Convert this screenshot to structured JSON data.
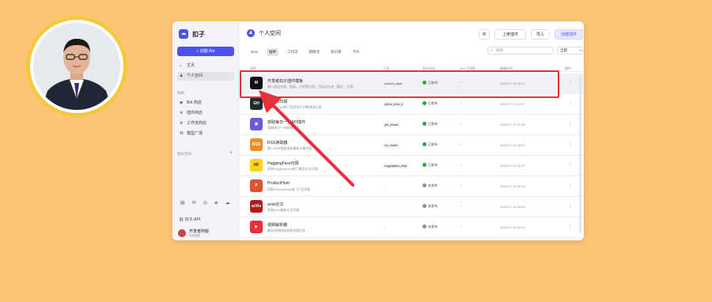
{
  "app": {
    "brand": "扣子",
    "create_bot": "+ 创建 Bot",
    "nav": [
      {
        "icon": "home-icon",
        "label": "主页",
        "glyph": "⌂"
      },
      {
        "icon": "person-icon",
        "label": "个人空间",
        "glyph": "♟"
      }
    ],
    "section_label": "探索",
    "explore": [
      {
        "icon": "bot-store-icon",
        "label": "Bot 商店",
        "glyph": "◉"
      },
      {
        "icon": "plugin-store-icon",
        "label": "插件商店",
        "glyph": "⊕"
      },
      {
        "icon": "workflow-store-icon",
        "label": "工作流商店",
        "glyph": "⚙"
      },
      {
        "icon": "model-plaza-icon",
        "label": "模型广场",
        "glyph": "⌘"
      }
    ],
    "team_label": "团队空间",
    "footer_brand": "扣子 API",
    "user_name": "开发者阿锐",
    "user_sub": "免费额度"
  },
  "workspace": {
    "title": "个人空间",
    "buttons": {
      "lang": "中",
      "publish": "上架插件",
      "import": "导入",
      "create": "创建插件"
    },
    "tabs": [
      "Bots",
      "插件",
      "工作流",
      "图像流",
      "知识库",
      "卡片"
    ],
    "search_placeholder": "搜索",
    "filter": "全部"
  },
  "table": {
    "headers": [
      "插件",
      "工具",
      "发布状态",
      "Bot 引用数",
      "编辑时间",
      "操作"
    ],
    "rows": [
      {
        "name": "开发者扣子插件模板",
        "desc": "输入商品名称、链接、介绍等内容，可自动生成（图片、文案）",
        "tool": "product_name",
        "status": "已发布",
        "status_color": "#1FA843",
        "refs": "-",
        "time": "2024-07-18 23:31",
        "icon_bg": "#111111",
        "icon_text": "M"
      },
      {
        "name": "GitHub日报",
        "desc": "获取GitHub热门项目排行并整理成日报",
        "tool": "github_trend_d",
        "status": "已发布",
        "status_color": "#1FA843",
        "refs": "-",
        "time": "2024-07-17 21:57",
        "icon_bg": "#24292F",
        "icon_text": "GH"
      },
      {
        "name": "获取每日一言API插件",
        "desc": "获取每日一句经典语录",
        "tool": "get_phrase",
        "status": "已发布",
        "status_color": "#1FA843",
        "refs": "-",
        "time": "2024-07-17 21:39",
        "icon_bg": "#6B5BD9",
        "icon_text": "▣"
      },
      {
        "name": "RSS读取器",
        "desc": "输入RSS链接读取最新文章内容",
        "tool": "rss_reader",
        "status": "已发布",
        "status_color": "#1FA843",
        "refs": "-",
        "time": "2024-07-15 18:57",
        "icon_bg": "#F08A24",
        "icon_text": "RSS"
      },
      {
        "name": "HuggingFace日报",
        "desc": "获取HuggingFace热门模型论文日报",
        "tool": "huggingface_daily",
        "status": "已发布",
        "status_color": "#1FA843",
        "refs": "-",
        "time": "2024-07-12 01:37",
        "icon_bg": "#FFD21E",
        "icon_text": "HF"
      },
      {
        "name": "ProductHunt",
        "desc": "获取ProductHunt热门产品列表",
        "tool": "",
        "status": "未发布",
        "status_color": "#8B8D96",
        "refs": "-",
        "time": "2024-07-12 23:18",
        "icon_bg": "#DA552F",
        "icon_text": "P"
      },
      {
        "name": "arxiv论文",
        "desc": "获取arxiv最新论文列表",
        "tool": "",
        "status": "未发布",
        "status_color": "#8B8D96",
        "refs": "-",
        "time": "2024-07-12 22:58",
        "icon_bg": "#B31B1B",
        "icon_text": "arXiv"
      },
      {
        "name": "视频解析器",
        "desc": "解析视频链接获取视频信息",
        "tool": "",
        "status": "未发布",
        "status_color": "#8B8D96",
        "refs": "-",
        "time": "2024-07-12 20:43",
        "icon_bg": "#E5313B",
        "icon_text": "▶"
      }
    ]
  },
  "colors": {
    "accent": "#4D53E8",
    "highlight": "#E5313B",
    "background": "#FDC475"
  }
}
